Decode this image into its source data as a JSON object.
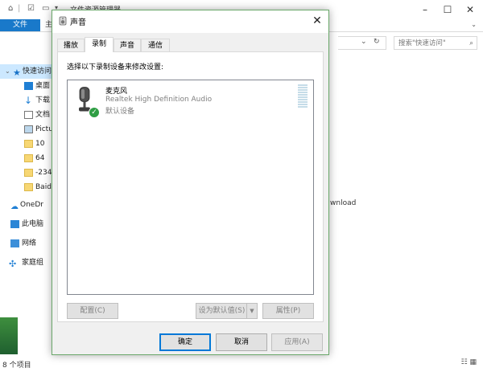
{
  "explorer": {
    "title": "文件资源管理器",
    "ribbon": {
      "file_tab": "文件",
      "tab_partial": "主"
    },
    "search_placeholder": "搜索\"快速访问\"",
    "nav_items": [
      {
        "label": "快速访问",
        "icon": "star-icon"
      },
      {
        "label": "桌面",
        "icon": "desktop-icon"
      },
      {
        "label": "下载",
        "icon": "download-arrow-icon"
      },
      {
        "label": "文档",
        "icon": "document-icon"
      },
      {
        "label": "Pictu",
        "icon": "pictures-icon"
      },
      {
        "label": "10",
        "icon": "folder-icon"
      },
      {
        "label": "64",
        "icon": "folder-icon"
      },
      {
        "label": "-234",
        "icon": "folder-icon"
      },
      {
        "label": "Baid",
        "icon": "folder-icon"
      },
      {
        "label": "OneDr",
        "icon": "cloud-icon"
      },
      {
        "label": "此电脑",
        "icon": "computer-icon"
      },
      {
        "label": "网络",
        "icon": "network-icon"
      },
      {
        "label": "家庭组",
        "icon": "homegroup-icon"
      }
    ],
    "right_text": "wnload",
    "status": "8 个项目"
  },
  "dialog": {
    "title": "声音",
    "tabs": [
      "播放",
      "录制",
      "声音",
      "通信"
    ],
    "active_tab": "录制",
    "instruction": "选择以下录制设备来修改设置:",
    "device": {
      "name": "麦克风",
      "description": "Realtek High Definition Audio",
      "status": "默认设备",
      "icon": "microphone-icon",
      "badge": "check-icon"
    },
    "panel_buttons": {
      "configure": "配置(C)",
      "set_default": "设为默认值(S)",
      "properties": "属性(P)"
    },
    "buttons": {
      "ok": "确定",
      "cancel": "取消",
      "apply": "应用(A)"
    },
    "close_glyph": "✕"
  },
  "colors": {
    "accent": "#0078d7",
    "file_tab": "#1979ca",
    "default_check": "#2f9e44",
    "dialog_border": "#6aa86a"
  }
}
